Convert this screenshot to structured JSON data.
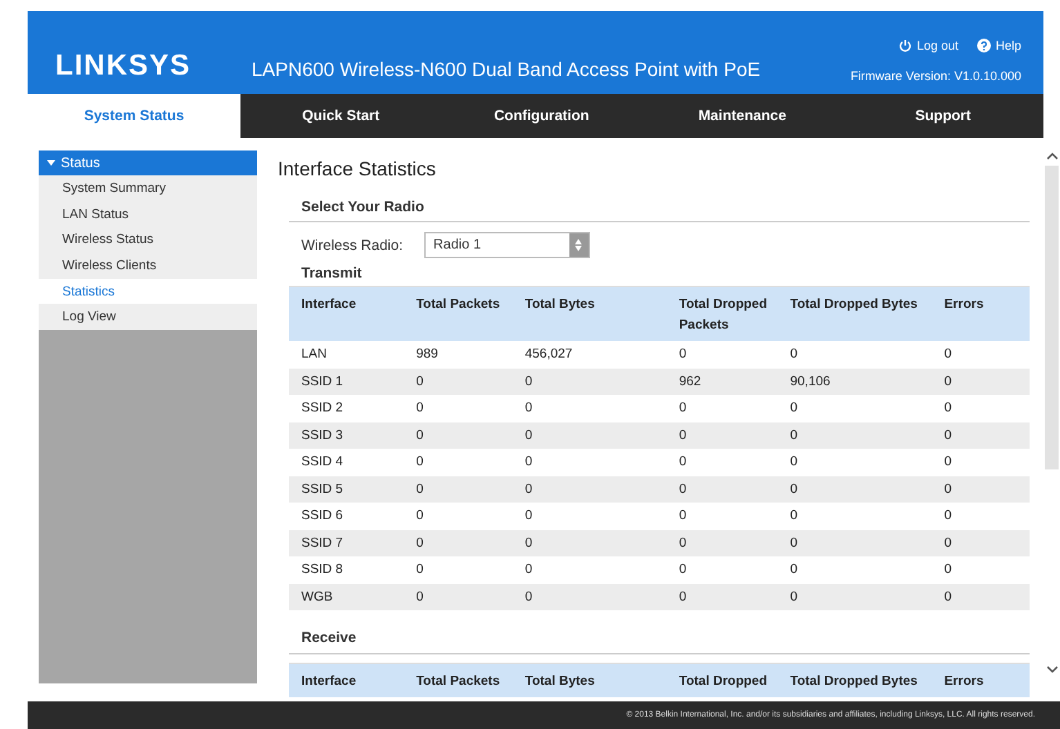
{
  "header": {
    "logo": "LINKSYS",
    "product": "LAPN600 Wireless-N600 Dual Band Access Point with PoE",
    "log_out": "Log out",
    "help": "Help",
    "firmware": "Firmware Version: V1.0.10.000"
  },
  "nav": [
    {
      "label": "System Status",
      "selected": true
    },
    {
      "label": "Quick Start",
      "selected": false
    },
    {
      "label": "Configuration",
      "selected": false
    },
    {
      "label": "Maintenance",
      "selected": false
    },
    {
      "label": "Support",
      "selected": false
    }
  ],
  "sidebar": {
    "group": "Status",
    "expanded": true,
    "items": [
      {
        "label": "System Summary",
        "selected": false
      },
      {
        "label": "LAN Status",
        "selected": false
      },
      {
        "label": "Wireless Status",
        "selected": false
      },
      {
        "label": "Wireless Clients",
        "selected": false
      },
      {
        "label": "Statistics",
        "selected": true
      },
      {
        "label": "Log View",
        "selected": false
      }
    ]
  },
  "content": {
    "title": "Interface Statistics",
    "section": "Select Your Radio",
    "radio_label": "Wireless Radio:",
    "radio_value": "Radio 1",
    "transmit": {
      "heading": "Transmit",
      "columns": [
        "Interface",
        "Total Packets",
        "Total Bytes",
        "Total Dropped Packets",
        "Total Dropped Bytes",
        "Errors"
      ],
      "rows": [
        [
          "LAN",
          "989",
          "456,027",
          "0",
          "0",
          "0"
        ],
        [
          "SSID 1",
          "0",
          "0",
          "962",
          "90,106",
          "0"
        ],
        [
          "SSID 2",
          "0",
          "0",
          "0",
          "0",
          "0"
        ],
        [
          "SSID 3",
          "0",
          "0",
          "0",
          "0",
          "0"
        ],
        [
          "SSID 4",
          "0",
          "0",
          "0",
          "0",
          "0"
        ],
        [
          "SSID 5",
          "0",
          "0",
          "0",
          "0",
          "0"
        ],
        [
          "SSID 6",
          "0",
          "0",
          "0",
          "0",
          "0"
        ],
        [
          "SSID 7",
          "0",
          "0",
          "0",
          "0",
          "0"
        ],
        [
          "SSID 8",
          "0",
          "0",
          "0",
          "0",
          "0"
        ],
        [
          "WGB",
          "0",
          "0",
          "0",
          "0",
          "0"
        ]
      ]
    },
    "receive": {
      "heading": "Receive",
      "columns": [
        "Interface",
        "Total Packets",
        "Total Bytes",
        "Total Dropped",
        "Total Dropped Bytes",
        "Errors"
      ]
    }
  },
  "footer": "© 2013 Belkin International, Inc. and/or its subsidiaries and affiliates, including Linksys, LLC. All rights reserved."
}
